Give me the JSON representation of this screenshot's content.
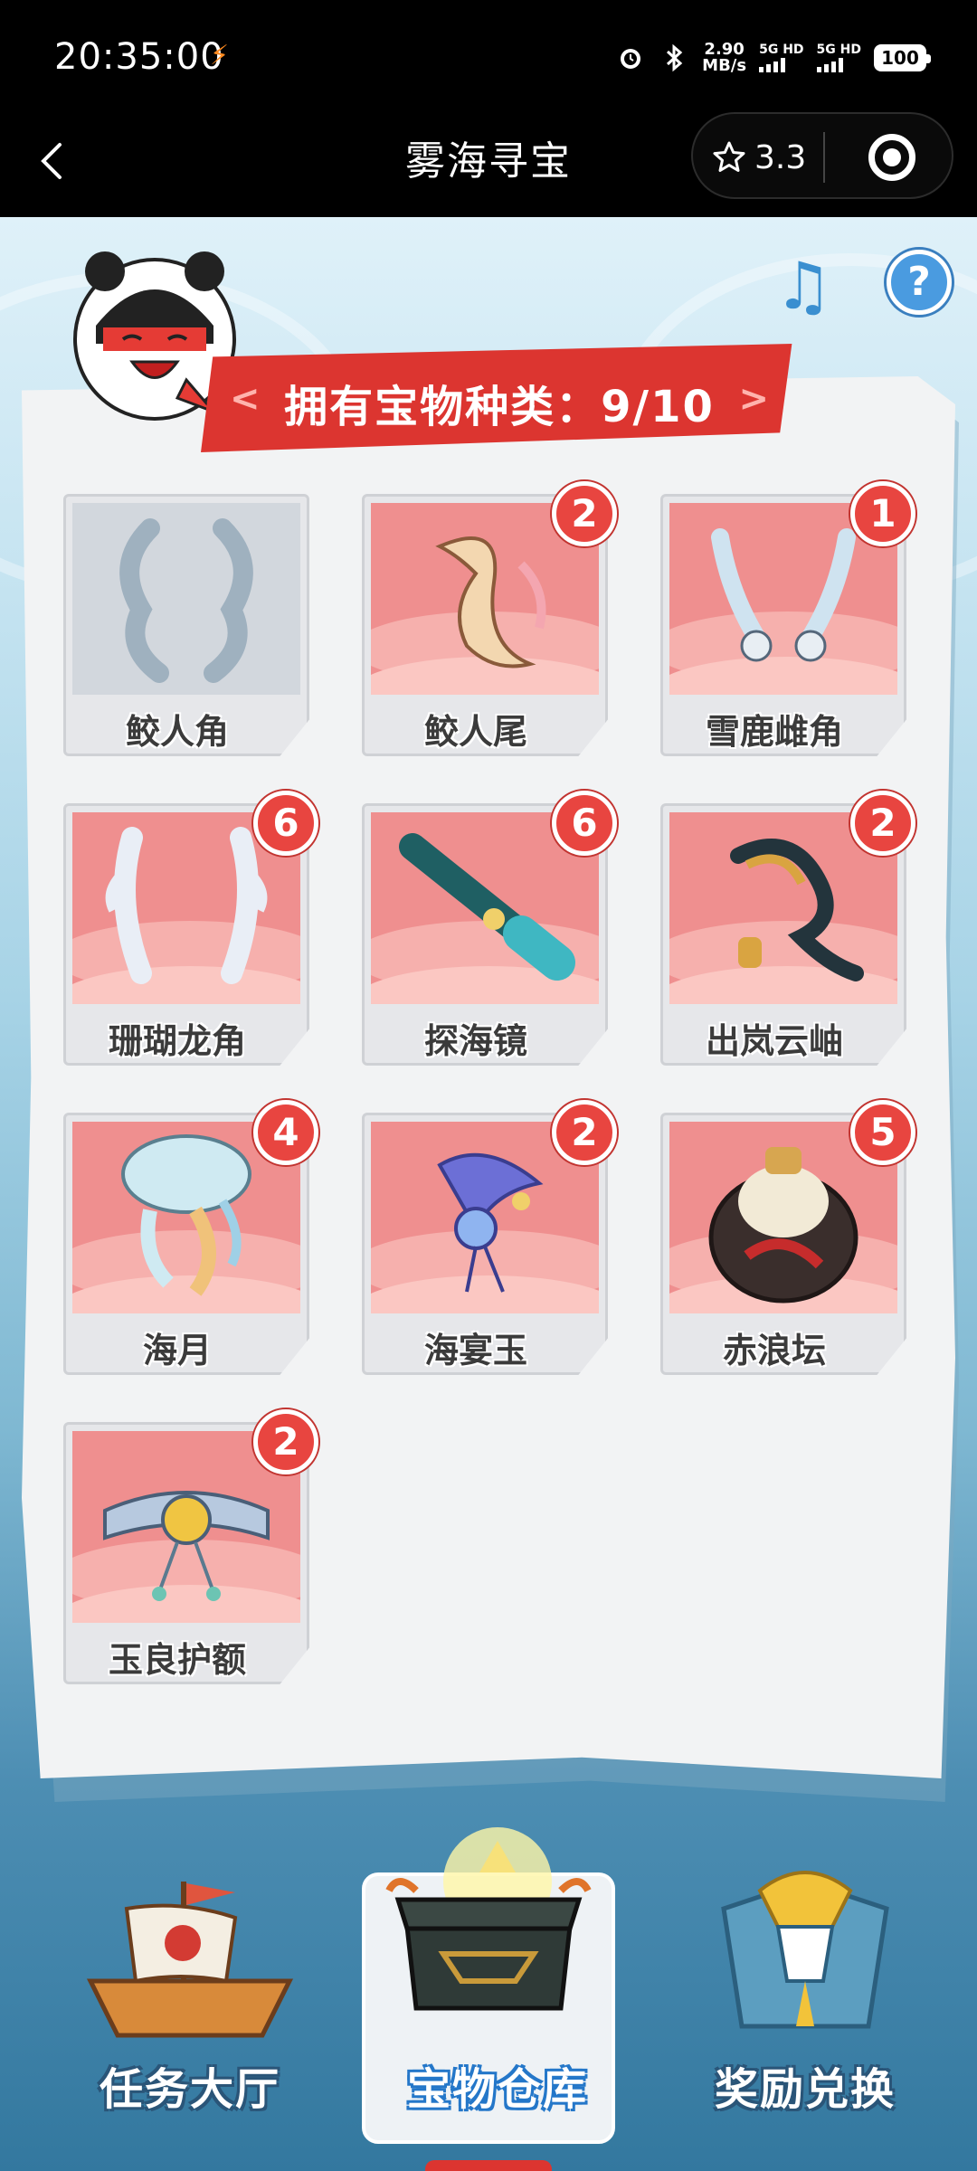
{
  "status_bar": {
    "time": "20:35:00",
    "net_speed_value": "2.90",
    "net_speed_unit": "MB/s",
    "sim1_label": "5G HD",
    "sim2_label": "5G HD",
    "battery": "100"
  },
  "titlebar": {
    "title": "雾海寻宝",
    "rating": "3.3"
  },
  "banner": {
    "label": "拥有宝物种类：",
    "count": "9/10"
  },
  "treasures": [
    {
      "name": "鲛人角",
      "count": "",
      "owned": false
    },
    {
      "name": "鲛人尾",
      "count": "2",
      "owned": true
    },
    {
      "name": "雪鹿雌角",
      "count": "1",
      "owned": true
    },
    {
      "name": "珊瑚龙角",
      "count": "6",
      "owned": true
    },
    {
      "name": "探海镜",
      "count": "6",
      "owned": true
    },
    {
      "name": "出岚云岫",
      "count": "2",
      "owned": true
    },
    {
      "name": "海月",
      "count": "4",
      "owned": true
    },
    {
      "name": "海宴玉",
      "count": "2",
      "owned": true
    },
    {
      "name": "赤浪坛",
      "count": "5",
      "owned": true
    },
    {
      "name": "玉良护额",
      "count": "2",
      "owned": true
    }
  ],
  "nav": {
    "items": [
      {
        "label": "任务大厅",
        "icon": "ship-icon"
      },
      {
        "label": "宝物仓库",
        "icon": "treasure-chest-icon"
      },
      {
        "label": "奖励兑换",
        "icon": "gift-box-icon"
      }
    ],
    "active_index": 1
  },
  "colors": {
    "banner_red": "#dc3530",
    "card_pink": "#ef8f8f",
    "badge_red": "#e84540",
    "accent_blue": "#4a9be0"
  }
}
